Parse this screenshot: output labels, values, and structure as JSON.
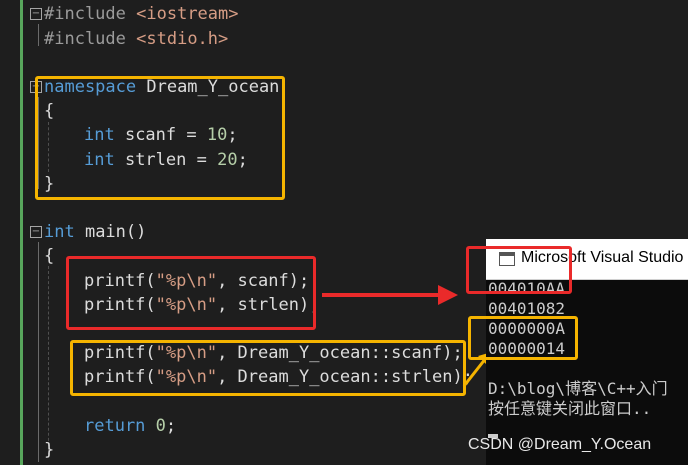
{
  "code": {
    "include1": {
      "directive": "#include",
      "header": "<iostream>"
    },
    "include2": {
      "directive": "#include",
      "header": "<stdio.h>"
    },
    "ns_keyword": "namespace",
    "ns_name": " Dream_Y_ocean",
    "open_brace": "{",
    "close_brace": "}",
    "var1": {
      "type": "int",
      "rest": " scanf = ",
      "value": "10",
      "end": ";"
    },
    "var2": {
      "type": "int",
      "rest": " strlen = ",
      "value": "20",
      "end": ";"
    },
    "main_type": "int",
    "main_sig": " main()",
    "printf1": {
      "call": "printf(",
      "fmt": "\"%p\\n\"",
      "args": ", scanf);"
    },
    "printf2": {
      "call": "printf(",
      "fmt": "\"%p\\n\"",
      "args": ", strlen);"
    },
    "printf3": {
      "call": "printf(",
      "fmt": "\"%p\\n\"",
      "args": ", Dream_Y_ocean::scanf);"
    },
    "printf4": {
      "call": "printf(",
      "fmt": "\"%p\\n\"",
      "args": ", Dream_Y_ocean::strlen);"
    },
    "return_kw": "return",
    "return_val": "0",
    "return_end": ";",
    "fold_sign": "−"
  },
  "console": {
    "title": "Microsoft Visual Studio",
    "lines": [
      "004010AA",
      "00401082",
      "0000000A",
      "00000014",
      "",
      "D:\\blog\\博客\\C++入门",
      "按任意键关闭此窗口.."
    ]
  },
  "watermark": "CSDN @Dream_Y.Ocean",
  "colors": {
    "highlight_orange": "#f5b400",
    "highlight_red": "#ea2a2a",
    "keyword": "#569cd6",
    "string": "#d69d85",
    "number": "#b5cea8"
  }
}
